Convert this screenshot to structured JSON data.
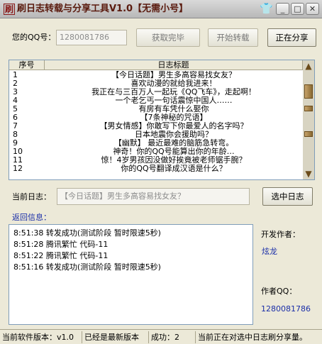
{
  "window": {
    "title": "刷日志转载与分享工具V1.0【无需小号】",
    "controls": {
      "minimize": "_",
      "maximize": "□",
      "close": "✕"
    }
  },
  "qq": {
    "label": "您的QQ号：",
    "value": "1280081786"
  },
  "buttons": {
    "fetch_done": "获取完毕",
    "start_repost": "开始转载",
    "sharing": "正在分享",
    "select_log": "选中日志"
  },
  "log_list": {
    "columns": [
      "序号",
      "日志标题"
    ],
    "rows": [
      {
        "n": "1",
        "title": "【今日话题】男生多高容易找女友？"
      },
      {
        "n": "2",
        "title": "喜欢动漫的就给我进来！"
      },
      {
        "n": "3",
        "title": "我正在与三百万人一起玩《QQ飞车》，走起啊！"
      },
      {
        "n": "4",
        "title": "一个老乞丐一句话震惊中国人……"
      },
      {
        "n": "5",
        "title": "有房有车凭什么娶你"
      },
      {
        "n": "6",
        "title": "【7条神秘的咒语】"
      },
      {
        "n": "7",
        "title": "【男女情感】你敢写下你最爱人的名字吗？"
      },
      {
        "n": "8",
        "title": "日本地震你会援助吗？"
      },
      {
        "n": "9",
        "title": "【幽默】 最近最难的脑筋急转弯。"
      },
      {
        "n": "10",
        "title": "神奇！你的QQ号能算出你的年龄…"
      },
      {
        "n": "11",
        "title": "惊！4岁男孩因没做好挨竟被老师锯手腕？"
      },
      {
        "n": "12",
        "title": "你的QQ号翻译成汉语是什么？"
      }
    ]
  },
  "current_log": {
    "label": "当前日志：",
    "value": "【今日话题】男生多高容易找女友？"
  },
  "return_info": {
    "label": "返回信息：",
    "lines": [
      "8:51:38 转发成功(测试阶段 暂时限速5秒)",
      "8:51:28 腾讯繁忙 代码-11",
      "8:51:22 腾讯繁忙 代码-11",
      "8:51:16 转发成功(测试阶段 暂时限速5秒)"
    ]
  },
  "developer": {
    "label": "开发作者：",
    "name": "炫龙"
  },
  "author_qq": {
    "label": "作者QQ：",
    "value": "1280081786"
  },
  "statusbar": {
    "version": "当前软件版本：v1.0",
    "latest": "已经是最新版本",
    "success": "成功：2",
    "message": "当前正在对选中日志刷分享量。"
  }
}
